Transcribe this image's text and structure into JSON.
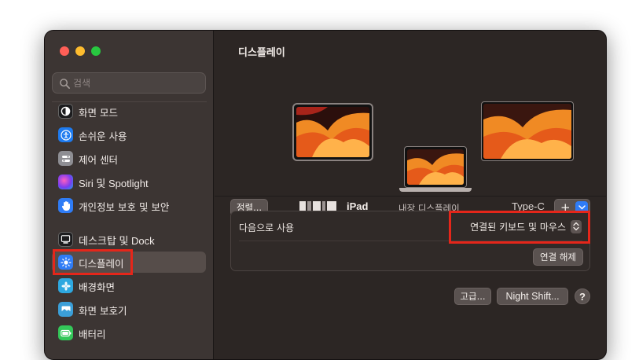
{
  "sidebar": {
    "search_placeholder": "검색",
    "items": [
      {
        "label": "화면 모드",
        "icon": "appearance-icon",
        "color": "#1c1c1e"
      },
      {
        "label": "손쉬운 사용",
        "icon": "accessibility-icon",
        "color": "#1e7bf0"
      },
      {
        "label": "제어 센터",
        "icon": "control-center-icon",
        "color": "#8e8e93"
      },
      {
        "label": "Siri 및 Spotlight",
        "icon": "siri-icon",
        "color": "#a64bd8"
      },
      {
        "label": "개인정보 보호 및 보안",
        "icon": "privacy-hand-icon",
        "color": "#2f7cf6"
      },
      {
        "label": "데스크탑 및 Dock",
        "icon": "desktop-dock-icon",
        "color": "#1c1c1e"
      },
      {
        "label": "디스플레이",
        "icon": "display-brightness-icon",
        "color": "#2f7cf6"
      },
      {
        "label": "배경화면",
        "icon": "wallpaper-icon",
        "color": "#2ea8e0"
      },
      {
        "label": "화면 보호기",
        "icon": "screensaver-icon",
        "color": "#3b9fd8"
      },
      {
        "label": "배터리",
        "icon": "battery-icon",
        "color": "#34c759"
      }
    ]
  },
  "main": {
    "title": "디스플레이",
    "arrange_button": "정렬...",
    "displays": [
      {
        "label": "iPad",
        "icon": "ipad-display-icon"
      },
      {
        "label": "내장 디스플레이",
        "icon": "builtin-display-icon"
      },
      {
        "label": "Type-C",
        "icon": "external-display-icon"
      }
    ],
    "add_button": "+",
    "use_as": {
      "label": "다음으로 사용",
      "value": "연결된 키보드 및 마우스"
    },
    "disconnect_button": "연결 해제",
    "advanced_button": "고급...",
    "night_shift_button": "Night Shift...",
    "help_button": "?"
  },
  "colors": {
    "highlight_box": "#e5261a",
    "accent": "#2f7cf6"
  }
}
